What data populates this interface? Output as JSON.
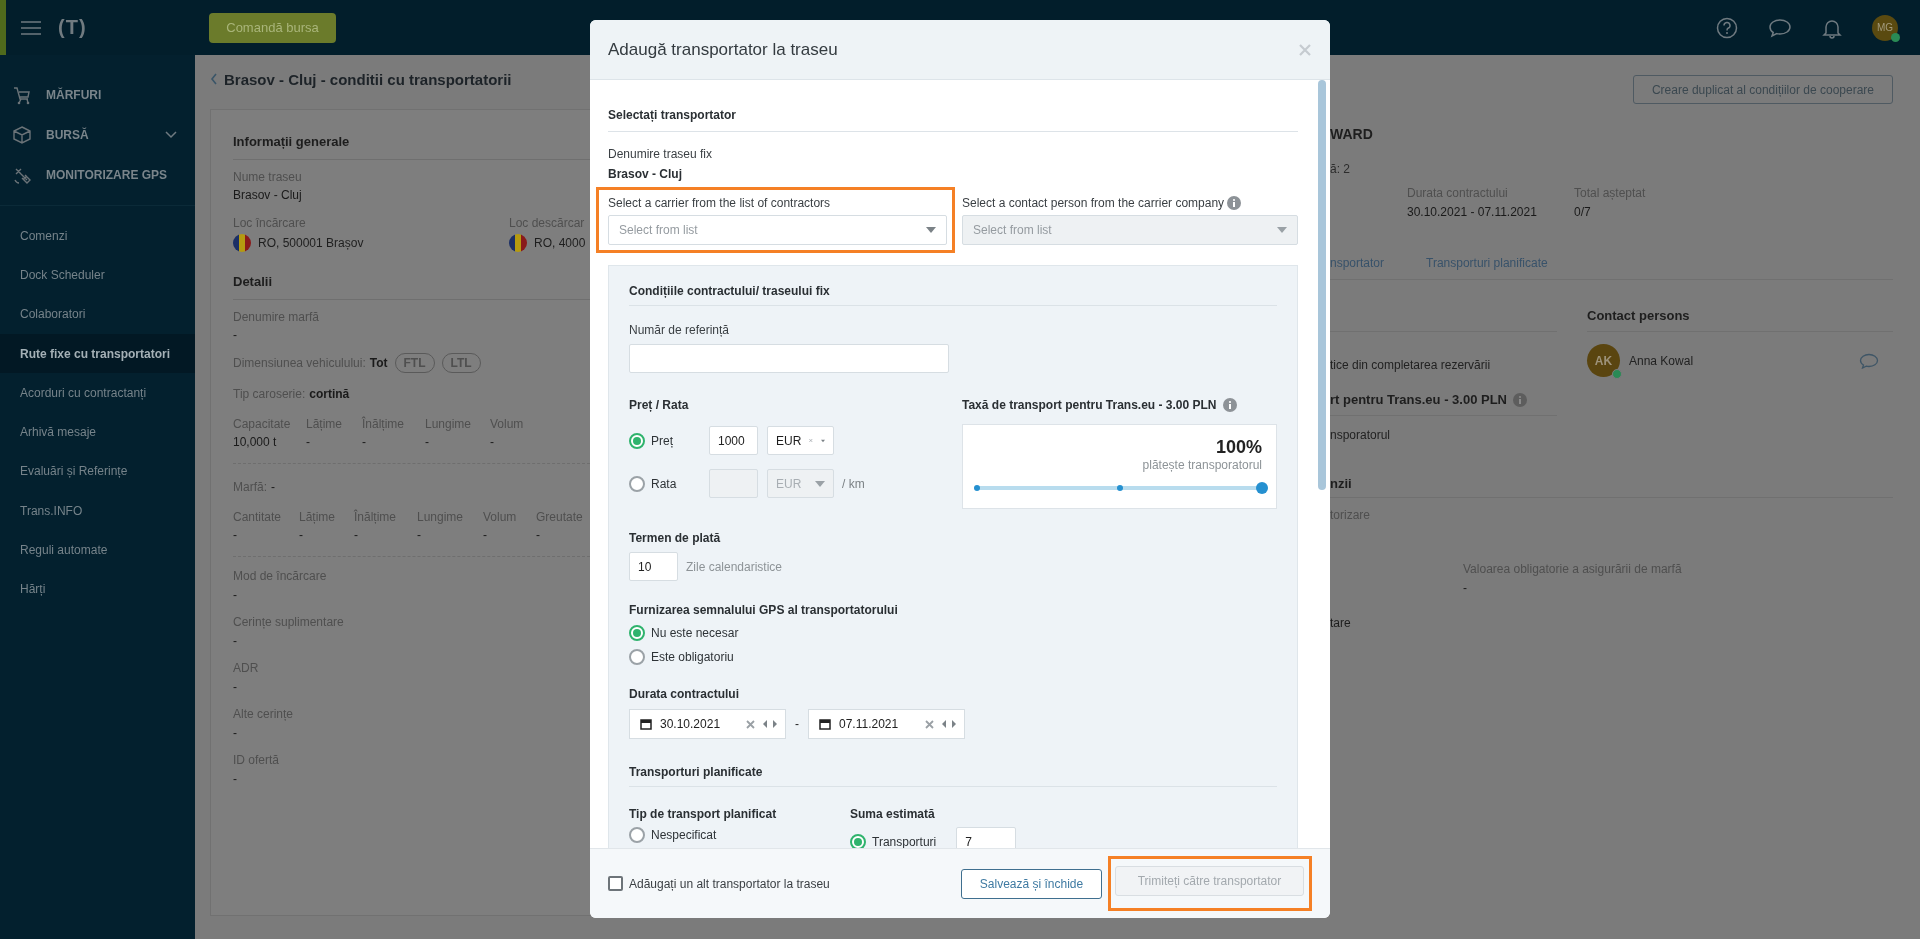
{
  "topbar": {
    "logo": "(T)",
    "exchange_button": "Comandă bursa",
    "avatar": "MG",
    "avatar_online": true
  },
  "sidebar": {
    "main_items": [
      {
        "label": "MĂRFURI",
        "kind": "cart",
        "expandable": false
      },
      {
        "label": "BURSĂ",
        "kind": "box",
        "expandable": true
      },
      {
        "label": "MONITORIZARE GPS",
        "kind": "satellite",
        "expandable": false
      }
    ],
    "items": [
      {
        "label": "Comenzi",
        "selected": false
      },
      {
        "label": "Dock Scheduler",
        "selected": false
      },
      {
        "label": "Colaboratori",
        "selected": false
      },
      {
        "label": "Rute fixe cu transportatori",
        "selected": true
      },
      {
        "label": "Acorduri cu contractanți",
        "selected": false
      },
      {
        "label": "Arhivă mesaje",
        "selected": false
      },
      {
        "label": "Evaluări și Referințe",
        "selected": false
      },
      {
        "label": "Trans.INFO",
        "selected": false
      },
      {
        "label": "Reguli automate",
        "selected": false
      },
      {
        "label": "Hărți",
        "selected": false
      }
    ]
  },
  "page_title": "Brasov - Cluj - conditii cu transportatorii",
  "general_info": {
    "heading": "Informații generale",
    "route_label": "Nume traseu",
    "route_value": "Brasov - Cluj",
    "loading_label": "Loc încărcare",
    "loading_value": "RO, 500001 Brașov",
    "unloading_label": "Loc descărcar",
    "unloading_value": "RO, 4000"
  },
  "details": {
    "heading": "Detalii",
    "goods_label": "Denumire marfă",
    "goods_value": "-",
    "vehicle_size_label": "Dimensiunea vehiculului:",
    "vehicle_size_value": "Tot",
    "vehicle_tags": [
      "FTL",
      "LTL"
    ],
    "body_type_label": "Tip caroserie:",
    "body_type_value": "cortină",
    "vehicle_dims": [
      {
        "label": "Capacitate",
        "value": "10,000 t"
      },
      {
        "label": "Lățime",
        "value": "-"
      },
      {
        "label": "Înălțime",
        "value": "-"
      },
      {
        "label": "Lungime",
        "value": "-"
      },
      {
        "label": "Volum",
        "value": "-"
      }
    ],
    "cargo_label": "Marfă:",
    "cargo_value": "-",
    "cargo_dims": [
      {
        "label": "Cantitate",
        "value": "-"
      },
      {
        "label": "Lățime",
        "value": "-"
      },
      {
        "label": "Înălțime",
        "value": "-"
      },
      {
        "label": "Lungime",
        "value": "-"
      },
      {
        "label": "Volum",
        "value": "-"
      },
      {
        "label": "Greutate",
        "value": "-"
      }
    ],
    "fields": [
      {
        "label": "Mod de încărcare",
        "value": "-"
      },
      {
        "label": "Cerințe suplimentare",
        "value": "-"
      },
      {
        "label": "ADR",
        "value": "-"
      },
      {
        "label": "Alte cerințe",
        "value": "-"
      },
      {
        "label": "ID ofertă",
        "value": "-"
      }
    ]
  },
  "right_panel": {
    "duplicate_button": "Creare duplicat al condițiilor de cooperare",
    "company_name": "WARD",
    "count_text": "ă: 2",
    "stats": [
      {
        "label": "Durata contractului",
        "value": "30.10.2021 - 07.11.2021"
      },
      {
        "label": "Total așteptat",
        "value": "0/7"
      }
    ],
    "tabs": [
      {
        "label": "nsportator",
        "selected": false
      },
      {
        "label": "Transporturi planificate",
        "selected": false
      }
    ],
    "booking_text": "tice din completarea rezervării",
    "fee_heading": "rt pentru Trans.eu - 3.00 PLN",
    "fee_text": "nsporatorul",
    "contacts_heading": "Contact persons",
    "contacts": [
      {
        "initials": "AK",
        "name": "Anna Kowal",
        "online": true
      }
    ],
    "section_heading": "nzii",
    "monitoring_text": "torizare",
    "insurance_label": "Valoarea obligatorie a asigurării de marfă",
    "insurance_value": "-",
    "last_text": "tare"
  },
  "modal": {
    "title": "Adaugă transportator la traseu",
    "carrier_heading": "Selectați transportator",
    "route_label": "Denumire traseu fix",
    "route_value": "Brasov - Cluj",
    "selects": [
      {
        "label": "Select a carrier from the list of contractors",
        "placeholder": "Select from list",
        "disabled": false,
        "highlighted": true,
        "info": false
      },
      {
        "label": "Select a contact person from the carrier company",
        "placeholder": "Select from list",
        "disabled": true,
        "highlighted": false,
        "info": true
      }
    ],
    "conditions": {
      "heading": "Condițiile contractului/ traseului fix",
      "reference_label": "Număr de referință",
      "price_heading": "Preț / Rata",
      "price_options": [
        {
          "label": "Preț",
          "selected": true,
          "amount": "1000",
          "currency": "EUR",
          "disabled": false
        },
        {
          "label": "Rata",
          "selected": false,
          "currency": "EUR",
          "disabled": true,
          "unit": "/ km"
        }
      ],
      "fee": {
        "heading": "Taxă de transport pentru Trans.eu - 3.00 PLN",
        "percent": "100%",
        "caption": "plătește transporatorul",
        "level": 1
      },
      "payment_heading": "Termen de plată",
      "payment_days": "10",
      "payment_unit": "Zile calendaristice",
      "gps_heading": "Furnizarea semnalului GPS al transportatorului",
      "gps_options": [
        {
          "label": "Nu este necesar",
          "selected": true
        },
        {
          "label": "Este obligatoriu",
          "selected": false
        }
      ],
      "duration_heading": "Durata contractului",
      "date_from": "30.10.2021",
      "date_separator": "-",
      "date_to": "07.11.2021",
      "planned_heading": "Transporturi planificate",
      "type_heading": "Tip de transport planificat",
      "type_options": [
        {
          "label": "Nespecificat",
          "selected": false
        }
      ],
      "amount_heading": "Suma estimată",
      "amount_options": [
        {
          "label": "Transporturi",
          "selected": true,
          "value": "7"
        }
      ]
    },
    "footer": {
      "add_another": {
        "label": "Adăugați un alt transportator la traseu",
        "checked": false
      },
      "save_button": "Salvează și închide",
      "send_button": {
        "label": "Trimiteți către transportator",
        "disabled": true,
        "highlighted": true
      }
    }
  }
}
